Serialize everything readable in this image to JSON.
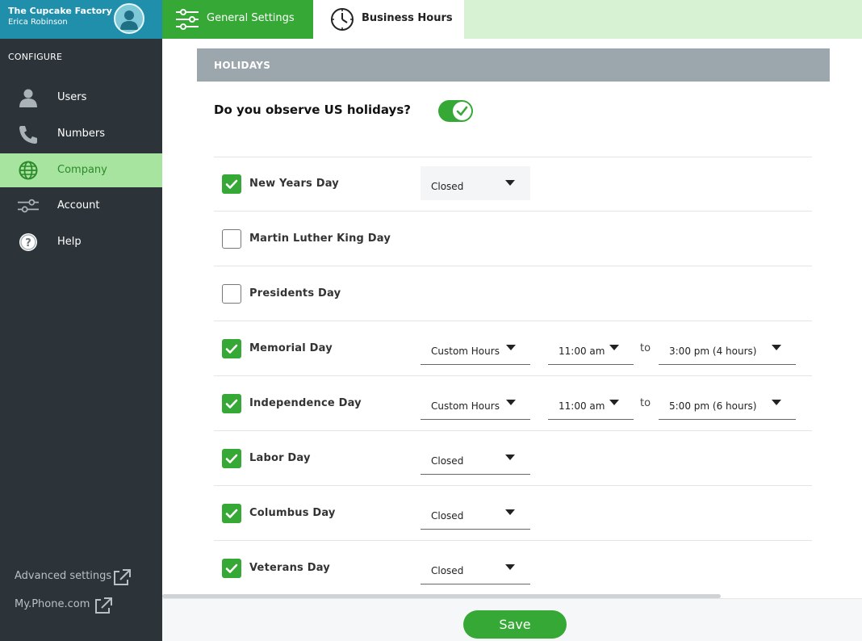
{
  "app": {
    "brand_name": "The Cupcake Factory",
    "user_name": "Erica Robinson"
  },
  "sidebar": {
    "section_label": "CONFIGURE",
    "items": [
      {
        "label": "Users",
        "icon": "user-icon"
      },
      {
        "label": "Numbers",
        "icon": "phone-icon"
      },
      {
        "label": "Company",
        "icon": "globe-icon",
        "active": true
      },
      {
        "label": "Account",
        "icon": "sliders-icon"
      },
      {
        "label": "Help",
        "icon": "help-icon"
      }
    ],
    "links": [
      {
        "label": "Advanced settings",
        "icon": "external-link-icon"
      },
      {
        "label": "My.Phone.com",
        "icon": "external-link-icon"
      }
    ]
  },
  "tabs": [
    {
      "label": "General Settings",
      "icon": "sliders-icon",
      "active": false
    },
    {
      "label": "Business Hours",
      "icon": "clock-icon",
      "active": true
    }
  ],
  "holidays": {
    "header": "HOLIDAYS",
    "question": "Do you observe US holidays?",
    "observe_enabled": true,
    "to_label": "to",
    "rows": [
      {
        "name": "New Years Day",
        "checked": true,
        "mode": "Closed"
      },
      {
        "name": "Martin Luther King Day",
        "checked": false
      },
      {
        "name": "Presidents Day",
        "checked": false
      },
      {
        "name": "Memorial Day",
        "checked": true,
        "mode": "Custom Hours",
        "start": "11:00 am",
        "end": "3:00 pm (4 hours)"
      },
      {
        "name": "Independence Day",
        "checked": true,
        "mode": "Custom Hours",
        "start": "11:00 am",
        "end": "5:00 pm (6 hours)"
      },
      {
        "name": "Labor Day",
        "checked": true,
        "mode": "Closed"
      },
      {
        "name": "Columbus Day",
        "checked": true,
        "mode": "Closed"
      },
      {
        "name": "Veterans Day",
        "checked": true,
        "mode": "Closed"
      }
    ]
  },
  "footer": {
    "save_label": "Save"
  },
  "colors": {
    "sidebar_bg": "#2c3439",
    "brand_bg": "#1f8fab",
    "accent_green": "#35a835",
    "active_nav_bg": "#a6e4a0",
    "tabbar_bg": "#d6f2d3",
    "section_header_bg": "#9ca6ad"
  }
}
